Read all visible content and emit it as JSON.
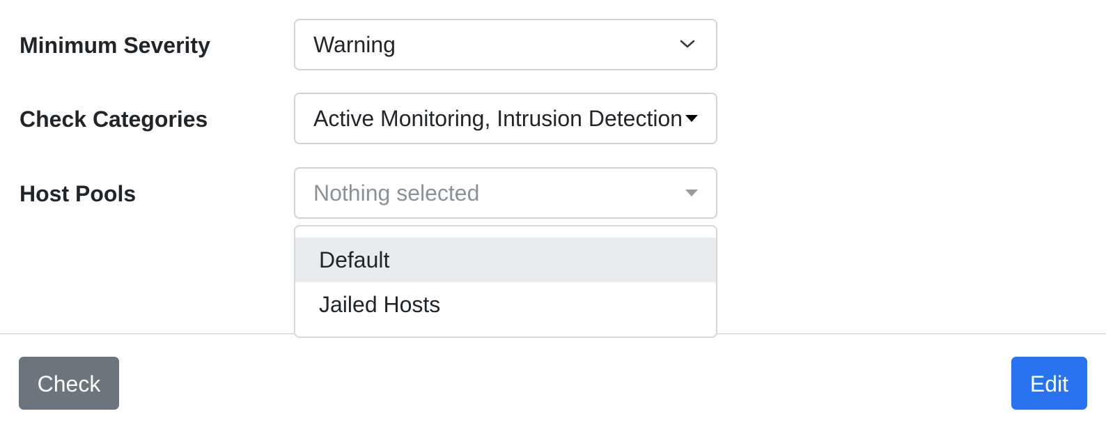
{
  "form": {
    "minimum_severity": {
      "label": "Minimum Severity",
      "value": "Warning",
      "icon": "chevron-down-icon"
    },
    "check_categories": {
      "label": "Check Categories",
      "value": "Active Monitoring, Intrusion Detection",
      "icon": "caret-down-icon"
    },
    "host_pools": {
      "label": "Host Pools",
      "placeholder": "Nothing selected",
      "icon": "caret-down-icon",
      "options": [
        {
          "label": "Default",
          "highlighted": true
        },
        {
          "label": "Jailed Hosts",
          "highlighted": false
        }
      ]
    }
  },
  "footer": {
    "check_label": "Check",
    "edit_label": "Edit"
  },
  "colors": {
    "check_button": "#6c757d",
    "edit_button": "#2a73f0",
    "highlight": "#e9ecef",
    "border": "#ced4da"
  }
}
